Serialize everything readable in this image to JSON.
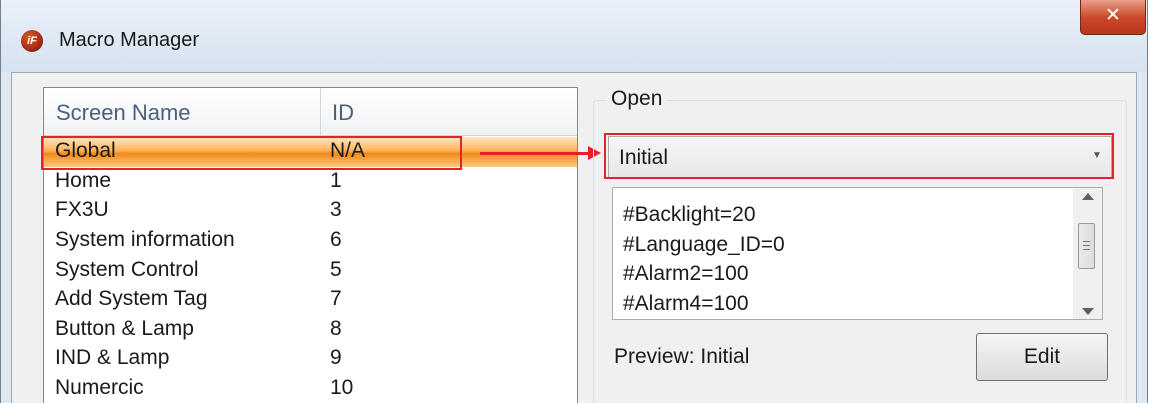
{
  "window": {
    "title": "Macro Manager",
    "icon": "app-logo-icon",
    "icon_text": "iF",
    "close_symbol": "✕"
  },
  "screen_list": {
    "columns": [
      "Screen Name",
      "ID"
    ],
    "rows": [
      {
        "name": "Global",
        "id": "N/A",
        "selected": true
      },
      {
        "name": "Home",
        "id": "1"
      },
      {
        "name": "FX3U",
        "id": "3"
      },
      {
        "name": "System information",
        "id": "6"
      },
      {
        "name": "System Control",
        "id": "5"
      },
      {
        "name": "Add System Tag",
        "id": "7"
      },
      {
        "name": "Button & Lamp",
        "id": "8"
      },
      {
        "name": "IND & Lamp",
        "id": "9"
      },
      {
        "name": "Numercic",
        "id": "10"
      }
    ]
  },
  "open_group": {
    "title": "Open",
    "selected_macro": "Initial",
    "macro_lines": [
      "#Backlight=20",
      "#Language_ID=0",
      "#Alarm2=100",
      "#Alarm4=100"
    ],
    "preview_label": "Preview: Initial",
    "edit_label": "Edit"
  },
  "colors": {
    "highlight_border": "#e8202a",
    "selected_row": "#f08a1a",
    "close_button": "#cc4a2a"
  }
}
